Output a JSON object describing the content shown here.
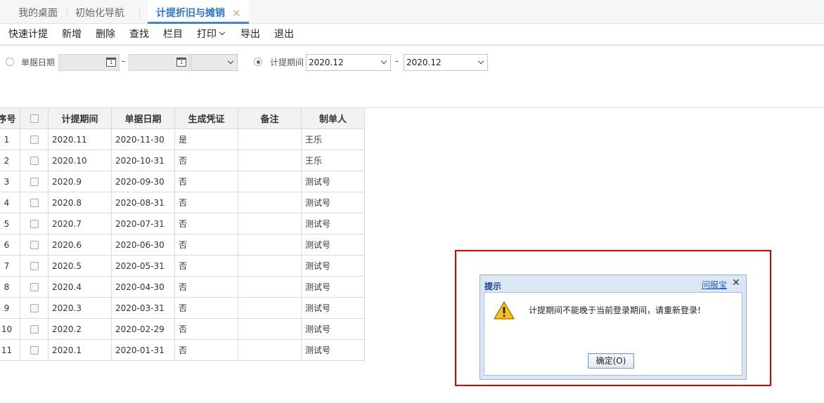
{
  "tabs": [
    {
      "label": "我的桌面"
    },
    {
      "label": "初始化导航"
    },
    {
      "label": "计提折旧与摊销",
      "close": "✕"
    }
  ],
  "toolbar": {
    "quick": "快速计提",
    "add": "新增",
    "delete": "删除",
    "find": "查找",
    "columns": "栏目",
    "print": "打印",
    "export": "导出",
    "exit": "退出"
  },
  "filter": {
    "doc_date_label": "单据日期",
    "period_label": "计提期间",
    "period_from": "2020.12",
    "period_to": "2020.12",
    "dash": "-",
    "calendar_glyph": "1"
  },
  "table": {
    "headers": {
      "no": "序号",
      "period": "计提期间",
      "date": "单据日期",
      "voucher": "生成凭证",
      "note": "备注",
      "maker": "制单人"
    },
    "rows": [
      {
        "no": "1",
        "period": "2020.11",
        "date": "2020-11-30",
        "voucher": "是",
        "note": "",
        "maker": "王乐"
      },
      {
        "no": "2",
        "period": "2020.10",
        "date": "2020-10-31",
        "voucher": "否",
        "note": "",
        "maker": "王乐"
      },
      {
        "no": "3",
        "period": "2020.9",
        "date": "2020-09-30",
        "voucher": "否",
        "note": "",
        "maker": "测试号"
      },
      {
        "no": "4",
        "period": "2020.8",
        "date": "2020-08-31",
        "voucher": "否",
        "note": "",
        "maker": "测试号"
      },
      {
        "no": "5",
        "period": "2020.7",
        "date": "2020-07-31",
        "voucher": "否",
        "note": "",
        "maker": "测试号"
      },
      {
        "no": "6",
        "period": "2020.6",
        "date": "2020-06-30",
        "voucher": "否",
        "note": "",
        "maker": "测试号"
      },
      {
        "no": "7",
        "period": "2020.5",
        "date": "2020-05-31",
        "voucher": "否",
        "note": "",
        "maker": "测试号"
      },
      {
        "no": "8",
        "period": "2020.4",
        "date": "2020-04-30",
        "voucher": "否",
        "note": "",
        "maker": "测试号"
      },
      {
        "no": "9",
        "period": "2020.3",
        "date": "2020-03-31",
        "voucher": "否",
        "note": "",
        "maker": "测试号"
      },
      {
        "no": "10",
        "period": "2020.2",
        "date": "2020-02-29",
        "voucher": "否",
        "note": "",
        "maker": "测试号"
      },
      {
        "no": "11",
        "period": "2020.1",
        "date": "2020-01-31",
        "voucher": "否",
        "note": "",
        "maker": "测试号"
      }
    ]
  },
  "dialog": {
    "title": "提示",
    "help": "问服宝",
    "close": "✕",
    "message": "计提期间不能晚于当前登录期间，请重新登录!",
    "ok": "确定(O)"
  },
  "colors": {
    "accent": "#2b74d8",
    "highlight": "#e00000",
    "dialog_title": "#15428b"
  }
}
